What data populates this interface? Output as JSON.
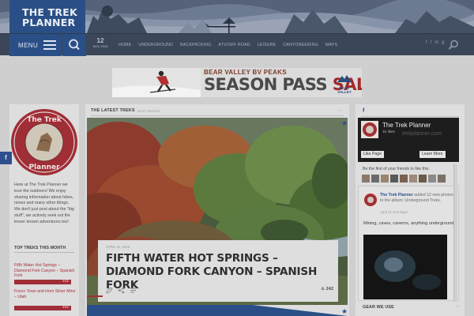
{
  "header": {
    "logo_line1": "THE TREK",
    "logo_line2": "PLANNER",
    "menu_label": "MENU",
    "date_day": "12",
    "date_month": "NOV 2018",
    "nav": [
      "HOME",
      "UNDERGROUND",
      "BACKPACKING",
      "ATV/OFF ROAD",
      "LEISURE",
      "CANYONEERING",
      "MAPS"
    ],
    "social": [
      "f",
      "t",
      "in",
      "g"
    ]
  },
  "ad": {
    "brand": "BEAR VALLEY BV PEAKS",
    "headline_main": "SEASON PASS ",
    "headline_accent": "SALE!",
    "logo_text_1": "BEAR",
    "logo_text_2": "VALLEY"
  },
  "left": {
    "badge_line1": "The Trek",
    "badge_line2": "Planner",
    "intro": "Here at The Trek Planner we love the outdoors! We enjoy sharing information about hikes, mines and many other things. We don't just post about the \"big stuff\", we actively seek out the lesser known adventures too!",
    "top_treks_heading": "TOP TREKS THIS MONTH",
    "top_treks": [
      {
        "title": "Fifth Water Hot Springs – Diamond Fork Canyon – Spanish Fork",
        "count": "242"
      },
      {
        "title": "Frisco Town and Horn Silver Mine – Utah",
        "count": "102"
      }
    ],
    "fb_tab": "f"
  },
  "main": {
    "section_title": "THE LATEST TREKS",
    "section_sub": "MOST RECENT",
    "card": {
      "date": "APRIL 16, 2015",
      "title": "FIFTH WATER HOT SPRINGS – DIAMOND FORK CANYON – SPANISH FORK",
      "likes": "242"
    }
  },
  "right": {
    "fb_heading": "f",
    "page_name": "The Trek Planner",
    "page_likes": "1K likes",
    "like_btn": "Like Page",
    "learn_btn": "Learn More",
    "watermark": "trekplanner.com",
    "friends_text": "Be the first of your friends to like this",
    "post_author": "The Trek Planner",
    "post_action": "added 12 new photos to the album: Underground Treks.",
    "post_time": "April 21 at 5:05pm",
    "post_message": "Mining, caves, caverns, anything underground!",
    "gear_heading": "GEAR WE USE"
  },
  "colors": {
    "brand_blue": "#2a4f86",
    "nav_bg": "#3b4658",
    "accent_red": "#a02e37",
    "facebook_blue": "#2e4f8e"
  }
}
